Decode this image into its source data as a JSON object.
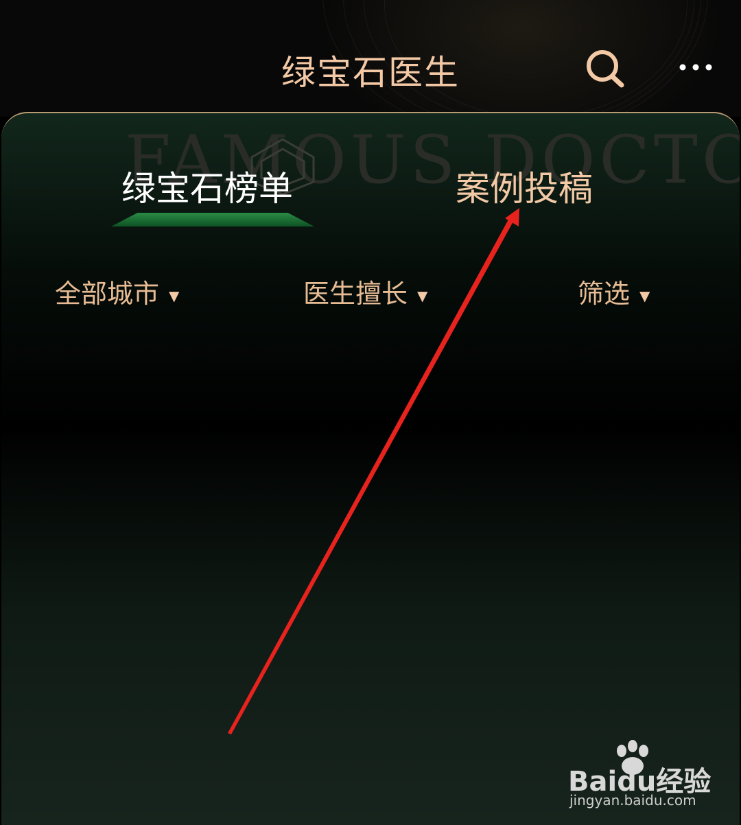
{
  "header": {
    "title": "绿宝石医生",
    "icons": [
      "search-icon",
      "more-icon"
    ]
  },
  "card": {
    "watermark": "FAMOUS DOCTOR",
    "tabs": [
      {
        "label": "绿宝石榜单",
        "active": true
      },
      {
        "label": "案例投稿",
        "active": false
      }
    ],
    "filters": [
      {
        "label": "全部城市"
      },
      {
        "label": "医生擅长"
      },
      {
        "label": "筛选"
      }
    ]
  },
  "watermark": {
    "brand": "Baidu经验",
    "url": "jingyan.baidu.com"
  },
  "colors": {
    "accent": "#f3c9a6",
    "active_tab": "#ffffff",
    "indicator": "#1f7a3a",
    "annotation_arrow": "#e8231e"
  }
}
